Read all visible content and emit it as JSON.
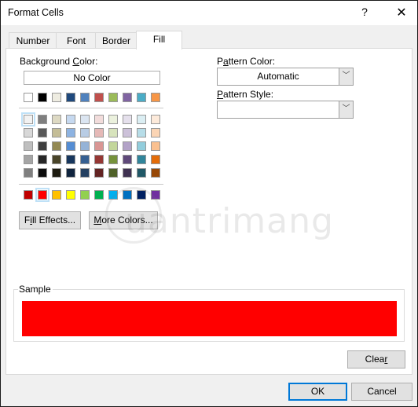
{
  "window": {
    "title": "Format Cells",
    "help_label": "?",
    "close_label": "✕"
  },
  "tabs": [
    {
      "label": "Number",
      "active": false
    },
    {
      "label": "Font",
      "active": false
    },
    {
      "label": "Border",
      "active": false
    },
    {
      "label": "Fill",
      "active": true
    }
  ],
  "fill": {
    "background_color_label_pre": "Background ",
    "background_color_label_key": "C",
    "background_color_label_post": "olor:",
    "no_color_label": "No Color",
    "theme_top_row": [
      "#ffffff",
      "#000000",
      "#eeece1",
      "#1f497d",
      "#4f81bd",
      "#c0504d",
      "#9bbb59",
      "#8064a2",
      "#4bacc6",
      "#f79646"
    ],
    "theme_shades": [
      [
        "#f2f2f2",
        "#7f7f7f",
        "#ddd9c3",
        "#c6d9f0",
        "#dbe5f1",
        "#f2dcdb",
        "#ebf1dd",
        "#e5e0ec",
        "#dbeef3",
        "#fdeada"
      ],
      [
        "#d8d8d8",
        "#595959",
        "#c4bd97",
        "#8db3e2",
        "#b8cce4",
        "#e5b9b7",
        "#d7e3bc",
        "#ccc1d9",
        "#b7dde8",
        "#fbd5b5"
      ],
      [
        "#bfbfbf",
        "#3f3f3f",
        "#938953",
        "#548dd4",
        "#95b3d7",
        "#d99694",
        "#c3d69b",
        "#b2a2c7",
        "#92cddc",
        "#fac08f"
      ],
      [
        "#a5a5a5",
        "#262626",
        "#494429",
        "#17365d",
        "#366092",
        "#953734",
        "#76923c",
        "#5f497a",
        "#31859b",
        "#e36c09"
      ],
      [
        "#7f7f7f",
        "#0c0c0c",
        "#1d1b10",
        "#0f243e",
        "#244061",
        "#632423",
        "#4f6128",
        "#3f3151",
        "#205867",
        "#974806"
      ]
    ],
    "standard_colors": [
      "#c00000",
      "#ff0000",
      "#ffc000",
      "#ffff00",
      "#92d050",
      "#00b050",
      "#00b0f0",
      "#0070c0",
      "#002060",
      "#7030a0"
    ],
    "selected_standard_index": 1,
    "selected_theme_row": 0,
    "selected_theme_col": 0,
    "fill_effects_pre": "F",
    "fill_effects_key": "i",
    "fill_effects_post": "ll Effects...",
    "more_colors_key": "M",
    "more_colors_post": "ore Colors...",
    "pattern_color_label_pre": "P",
    "pattern_color_label_key": "a",
    "pattern_color_label_post": "ttern Color:",
    "pattern_color_value": "Automatic",
    "pattern_style_label_key": "P",
    "pattern_style_label_post": "attern Style:",
    "pattern_style_value": "",
    "dropdown_arrow": "﹀",
    "sample_label": "Sample",
    "sample_color": "#ff0000",
    "clear_pre": "Clea",
    "clear_key": "r"
  },
  "footer": {
    "ok_label": "OK",
    "cancel_label": "Cancel"
  },
  "watermark": {
    "text": "uantrimang"
  }
}
